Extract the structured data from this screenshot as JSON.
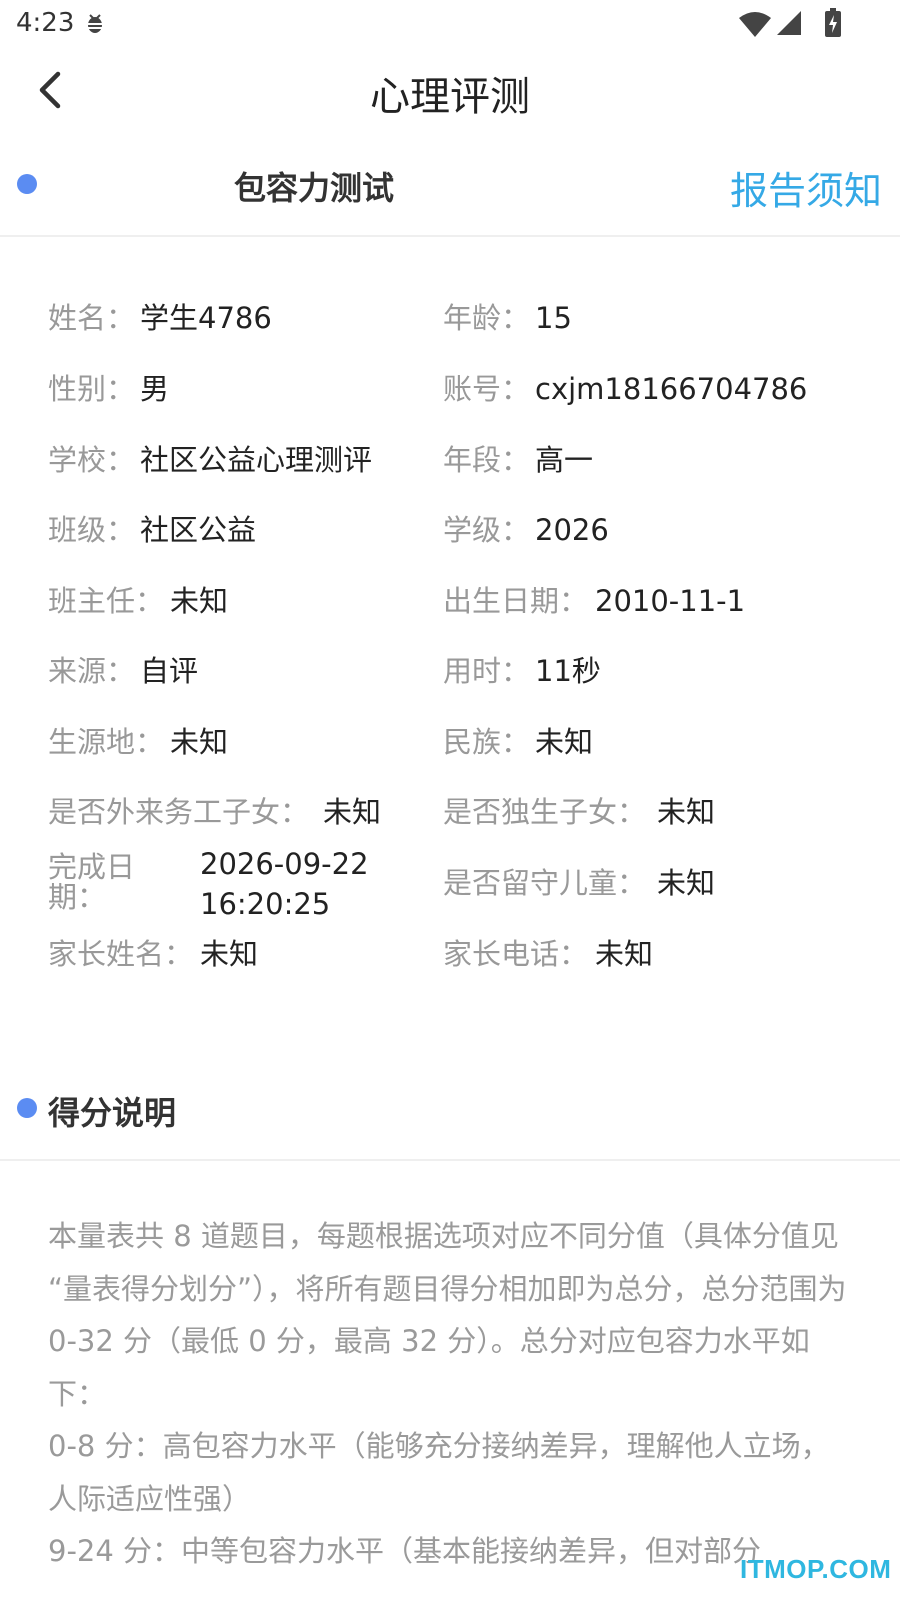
{
  "status_bar": {
    "time": "4:23"
  },
  "header": {
    "title": "心理评测"
  },
  "test": {
    "name": "包容力测试",
    "report_link": "报告须知"
  },
  "info": [
    {
      "label": "姓名：",
      "value": "学生4786"
    },
    {
      "label": "年龄：",
      "value": "15"
    },
    {
      "label": "性别：",
      "value": "男"
    },
    {
      "label": "账号：",
      "value": "cxjm18166704786"
    },
    {
      "label": "学校：",
      "value": "社区公益心理测评"
    },
    {
      "label": "年段：",
      "value": "高一"
    },
    {
      "label": "班级：",
      "value": "社区公益"
    },
    {
      "label": "学级：",
      "value": "2026"
    },
    {
      "label": "班主任：",
      "value": "未知"
    },
    {
      "label": "出生日期：",
      "value": "2010-11-1"
    },
    {
      "label": "来源：",
      "value": "自评"
    },
    {
      "label": "用时：",
      "value": "11秒"
    },
    {
      "label": "生源地：",
      "value": "未知"
    },
    {
      "label": "民族：",
      "value": "未知"
    },
    {
      "label": "是否外来务工子女：",
      "value": "未知"
    },
    {
      "label": "是否独生子女：",
      "value": "未知"
    },
    {
      "label": "完成日期：",
      "value": "2026-09-22 16:20:25"
    },
    {
      "label": "是否留守儿童：",
      "value": "未知"
    },
    {
      "label": "家长姓名：",
      "value": "未知"
    },
    {
      "label": "家长电话：",
      "value": "未知"
    }
  ],
  "score": {
    "title": "得分说明",
    "paragraphs": [
      "本量表共 8 道题目，每题根据选项对应不同分值（具体分值见 “量表得分划分”），将所有题目得分相加即为总分，总分范围为 0-32 分（最低 0 分，最高 32 分）。总分对应包容力水平如下：",
      "0-8 分：高包容力水平（能够充分接纳差异，理解他人立场，人际适应性强）",
      "9-24 分：中等包容力水平（基本能接纳差异，但对部分"
    ]
  },
  "watermark": "ITMOP.COM",
  "colors": {
    "accent_dot": "#5b8cf2",
    "link": "#35a9e6"
  }
}
